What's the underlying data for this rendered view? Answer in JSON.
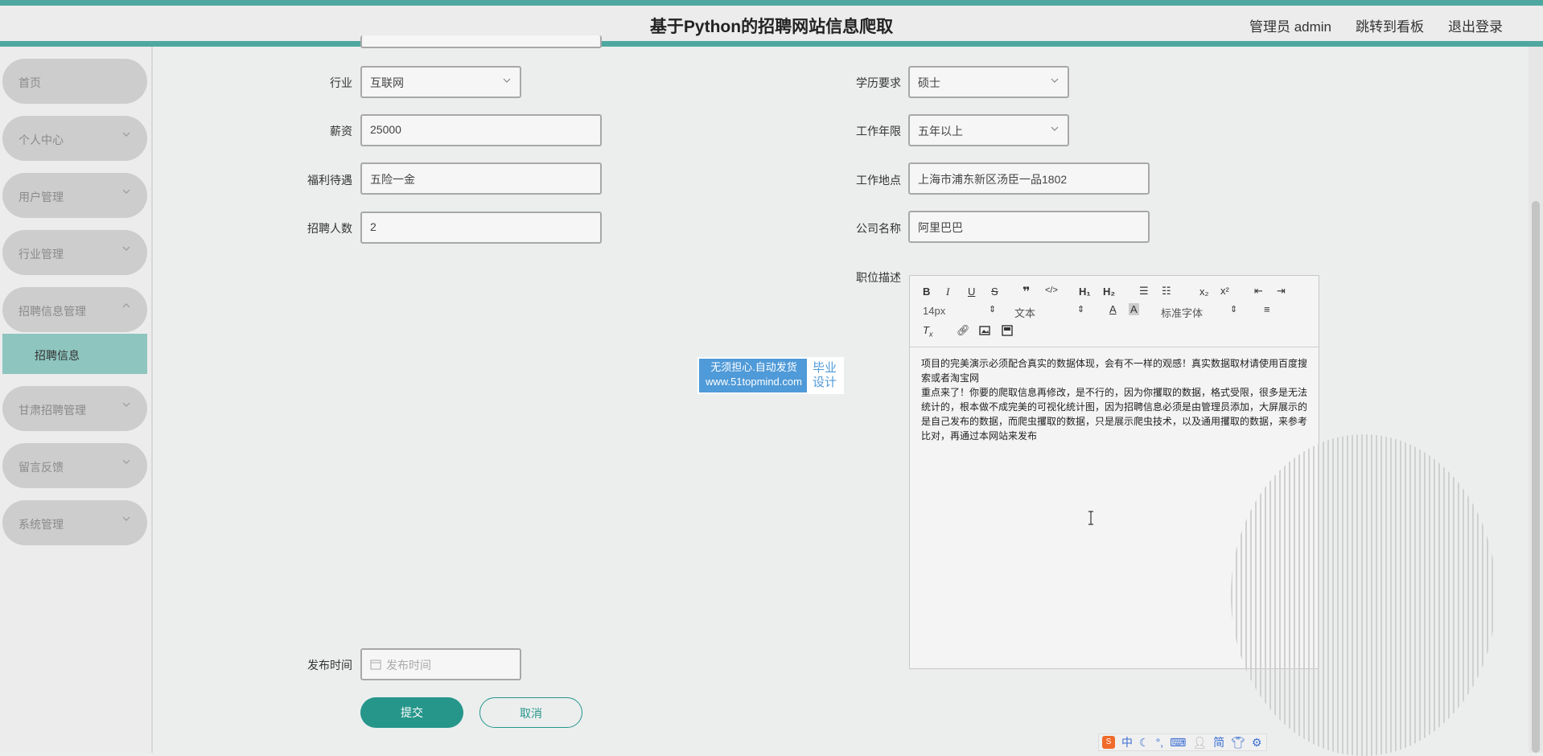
{
  "header": {
    "title": "基于Python的招聘网站信息爬取",
    "nav": [
      "管理员 admin",
      "跳转到看板",
      "退出登录"
    ]
  },
  "sidebar": {
    "items": [
      {
        "label": "首页"
      },
      {
        "label": "个人中心"
      },
      {
        "label": "用户管理"
      },
      {
        "label": "行业管理"
      },
      {
        "label": "招聘信息管理"
      },
      {
        "label": "招聘信息"
      },
      {
        "label": "甘肃招聘管理"
      },
      {
        "label": "留言反馈"
      },
      {
        "label": "系统管理"
      }
    ]
  },
  "form": {
    "industry": {
      "label": "行业",
      "value": "互联网"
    },
    "education": {
      "label": "学历要求",
      "value": "硕士"
    },
    "salary": {
      "label": "薪资",
      "value": "25000"
    },
    "experience": {
      "label": "工作年限",
      "value": "五年以上"
    },
    "benefits": {
      "label": "福利待遇",
      "value": "五险一金"
    },
    "location": {
      "label": "工作地点",
      "value": "上海市浦东新区汤臣一品1802"
    },
    "headcount": {
      "label": "招聘人数",
      "value": "2"
    },
    "company": {
      "label": "公司名称",
      "value": "阿里巴巴"
    },
    "description": {
      "label": "职位描述"
    },
    "publish_time": {
      "label": "发布时间",
      "placeholder": "发布时间"
    }
  },
  "editor": {
    "font_size": "14px",
    "format": "文本",
    "font_family": "标准字体",
    "content": [
      "项目的完美演示必须配合真实的数据体现，会有不一样的观感！真实数据取材请使用百度搜索或者淘宝网",
      "重点来了！你要的爬取信息再修改，是不行的，因为你攫取的数据，格式受限，很多是无法统计的，根本做不成完美的可视化统计图，因为招聘信息必须是由管理员添加，大屏展示的是自己发布的数据，而爬虫攫取的数据，只是展示爬虫技术，以及通用攫取的数据，来参考比对，再通过本网站来发布"
    ]
  },
  "watermark": {
    "line1": "无须担心.自动发货",
    "line2": "www.51topmind.com",
    "badge1": "毕业",
    "badge2": "设计"
  },
  "buttons": {
    "submit": "提交",
    "cancel": "取消"
  },
  "ime": {
    "lang": "中",
    "mode": "简"
  },
  "colors": {
    "accent": "#26968b",
    "stripe": "#4fa89f",
    "active_menu": "#8ec5bf"
  }
}
